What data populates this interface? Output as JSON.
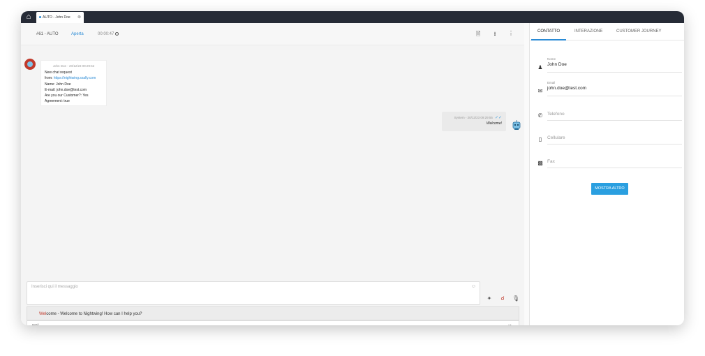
{
  "topbar": {
    "tab_label": "AUTO - John Doe",
    "home_icon": "home-icon"
  },
  "chat": {
    "ticket_id": "#61 - AUTO",
    "status": "Aperta",
    "timer": "00:00:47",
    "incoming": {
      "meta": "John Doe - 20/12/23 09:29:52",
      "line1": "New chat request",
      "from_label": "from:",
      "from_url": "https://nightwing.sxally.com",
      "line3": "Name: John Doe",
      "line4": "E-mail: john.doe@test.com",
      "line5": "Are you our Customer?: Yes",
      "line6": "Agreement: true"
    },
    "outgoing": {
      "meta": "System - 20/12/23 09:29:55",
      "text": "Welcome!"
    },
    "composer": {
      "placeholder": "Inserisci qui il messaggio"
    },
    "suggestion": {
      "match": "Wel",
      "rest": "come - Welcome to Nightwing! How can I help you?"
    },
    "typed": "wel"
  },
  "sidebar": {
    "tabs": [
      "CONTATTO",
      "INTERAZIONE",
      "CUSTOMER JOURNEY"
    ],
    "fields": {
      "name_label": "Nome",
      "name_value": "John Doe",
      "email_label": "Email",
      "email_value": "john.doe@test.com",
      "phone_placeholder": "Telefono",
      "mobile_placeholder": "Cellulare",
      "fax_placeholder": "Fax"
    },
    "more_button": "MOSTRA ALTRO"
  },
  "colors": {
    "accent": "#2a9fe0",
    "topbar": "#262b36",
    "highlight": "#c0392b"
  }
}
